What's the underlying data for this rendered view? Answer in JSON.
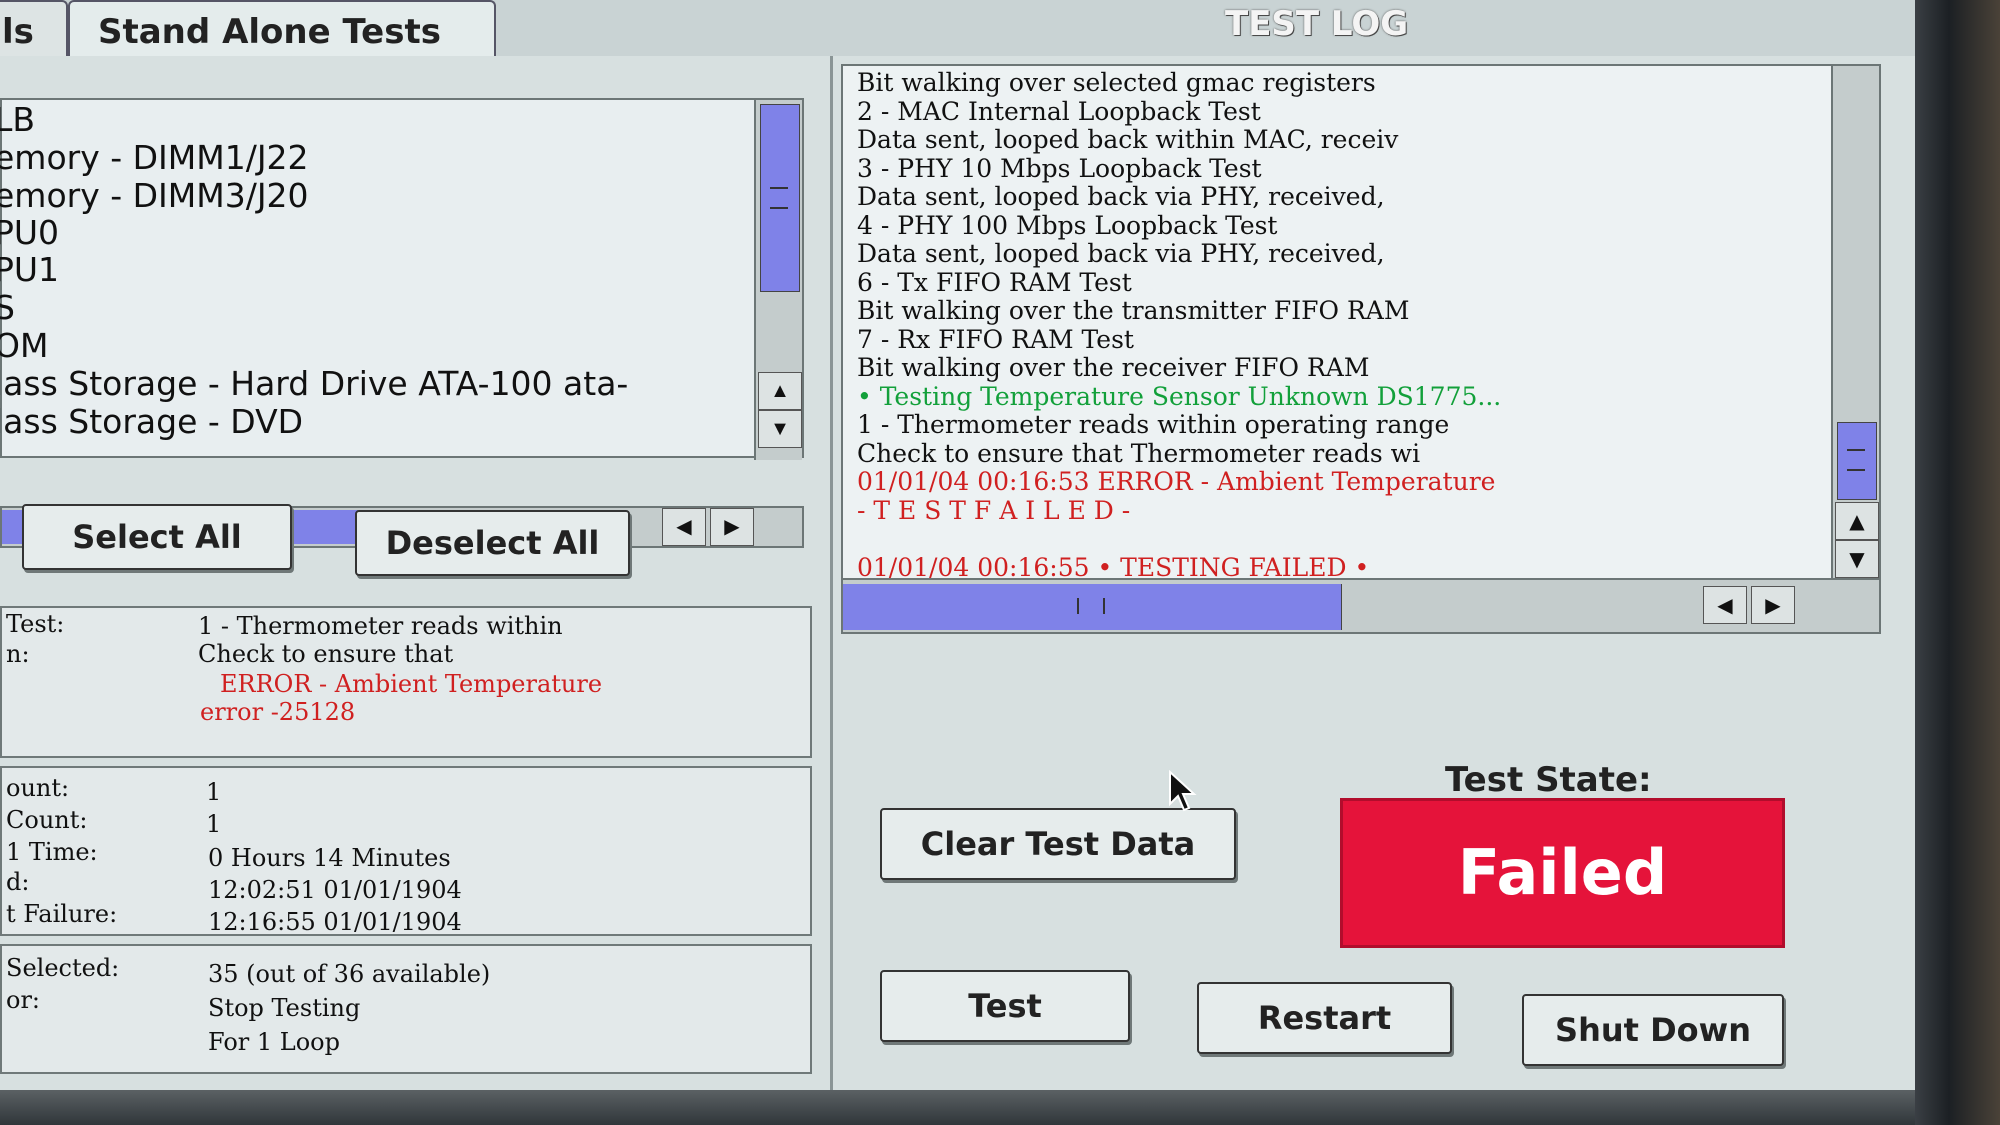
{
  "tabs": [
    {
      "label": "ls"
    },
    {
      "label": "Stand Alone Tests"
    }
  ],
  "log_title": "TEST LOG",
  "test_list": {
    "items": [
      "LB",
      "emory - DIMM1/J22",
      "emory - DIMM3/J20",
      "PU0",
      "PU1",
      "S",
      "OM",
      "lass Storage - Hard Drive ATA-100 ata-",
      "lass Storage - DVD"
    ]
  },
  "list_buttons": {
    "select_all": "Select All",
    "deselect_all": "Deselect All"
  },
  "current_test": {
    "test_label": "Test:",
    "test_value": "1 - Thermometer reads within",
    "desc_label": "n:",
    "desc_value": "Check to ensure that",
    "error_line1": "ERROR - Ambient Temperature",
    "error_line2": "error -25128"
  },
  "stats": {
    "row1_label": "ount:",
    "row1_value": "1",
    "row2_label": "Count:",
    "row2_value": "1",
    "row3_label": "1 Time:",
    "row3_value": "0 Hours 14 Minutes",
    "row4_label": "d:",
    "row4_value": "12:02:51 01/01/1904",
    "row5_label": "t Failure:",
    "row5_value": "12:16:55 01/01/1904"
  },
  "options": {
    "row1_label": "Selected:",
    "row1_value": "35 (out of 36 available)",
    "row2_label": "or:",
    "row2_value": "Stop Testing",
    "row3_value": "For 1 Loop"
  },
  "log_lines": [
    {
      "text": "      Bit walking over selected gmac registers",
      "color": "#111111"
    },
    {
      "text": "  2 - MAC Internal Loopback Test",
      "color": "#111111"
    },
    {
      "text": "      Data sent, looped back within MAC, receiv",
      "color": "#111111"
    },
    {
      "text": "  3 - PHY 10 Mbps Loopback Test",
      "color": "#111111"
    },
    {
      "text": "      Data sent, looped back via PHY, received,",
      "color": "#111111"
    },
    {
      "text": "  4 - PHY 100 Mbps Loopback Test",
      "color": "#111111"
    },
    {
      "text": "      Data sent, looped back via PHY, received,",
      "color": "#111111"
    },
    {
      "text": "  6 - Tx FIFO RAM Test",
      "color": "#111111"
    },
    {
      "text": "      Bit walking over the transmitter FIFO RAM",
      "color": "#111111"
    },
    {
      "text": "  7 - Rx FIFO RAM Test",
      "color": "#111111"
    },
    {
      "text": "      Bit walking over the receiver FIFO RAM",
      "color": "#111111"
    },
    {
      "text": "  • Testing Temperature Sensor Unknown DS1775...",
      "color": "#12a03a"
    },
    {
      "text": "  1 - Thermometer reads within operating range",
      "color": "#111111"
    },
    {
      "text": "      Check to ensure that Thermometer reads wi",
      "color": "#111111"
    },
    {
      "text": "01/01/04 00:16:53  ERROR - Ambient Temperature",
      "color": "#d02020"
    },
    {
      "text": "  - T E S T   F A I L E D -",
      "color": "#d02020"
    },
    {
      "text": "",
      "color": "#111111"
    },
    {
      "text": "01/01/04 00:16:55 • TESTING FAILED •",
      "color": "#d02020"
    }
  ],
  "actions": {
    "clear": "Clear Test Data",
    "test": "Test",
    "restart": "Restart",
    "shutdown": "Shut Down"
  },
  "test_state": {
    "label": "Test State:",
    "value": "Failed",
    "color": "#e5133a"
  }
}
